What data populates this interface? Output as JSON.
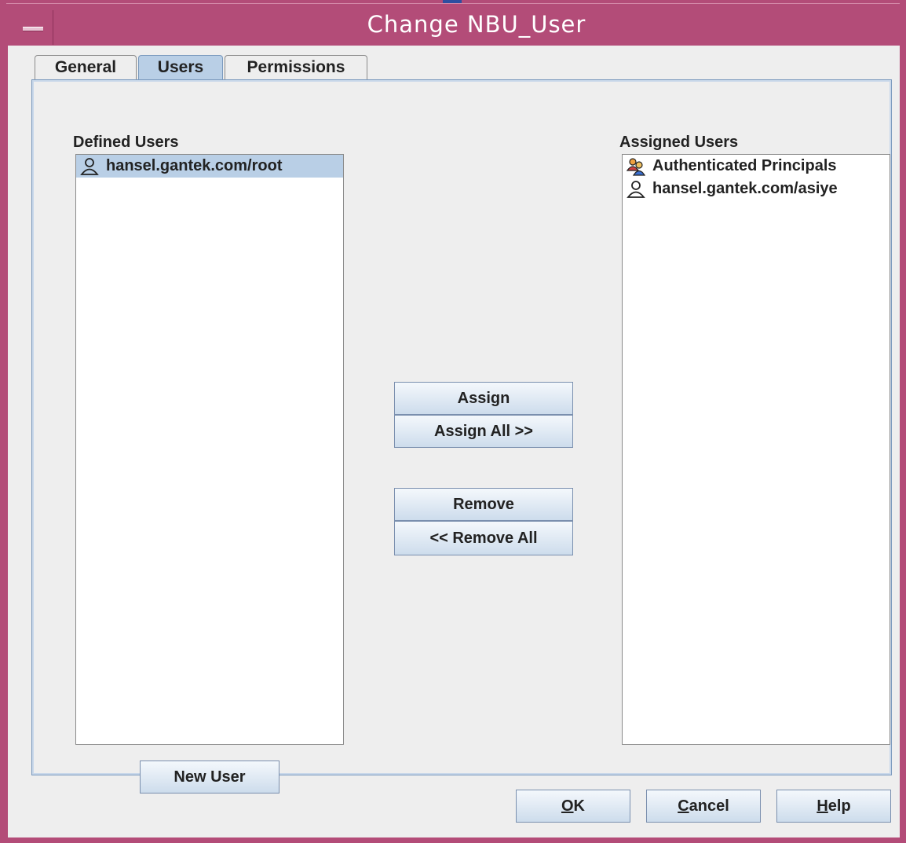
{
  "window": {
    "title": "Change NBU_User"
  },
  "tabs": [
    {
      "label": "General"
    },
    {
      "label": "Users"
    },
    {
      "label": "Permissions"
    }
  ],
  "defined_users": {
    "label": "Defined Users",
    "items": [
      {
        "name": "hansel.gantek.com/root",
        "icon": "user-icon"
      }
    ]
  },
  "assigned_users": {
    "label": "Assigned Users",
    "items": [
      {
        "name": "Authenticated Principals",
        "icon": "group-icon"
      },
      {
        "name": "hansel.gantek.com/asiye",
        "icon": "user-icon"
      }
    ]
  },
  "buttons": {
    "assign": "Assign",
    "assign_all": "Assign All >>",
    "remove": "Remove",
    "remove_all": "<< Remove All",
    "new_user": "New User",
    "ok_mnemonic": "O",
    "ok_rest": "K",
    "cancel_mnemonic": "C",
    "cancel_rest": "ancel",
    "help_mnemonic": "H",
    "help_rest": "elp"
  },
  "colors": {
    "titlebar": "#b34c78",
    "selection": "#b9cfe6",
    "panel": "#eeeeee"
  }
}
